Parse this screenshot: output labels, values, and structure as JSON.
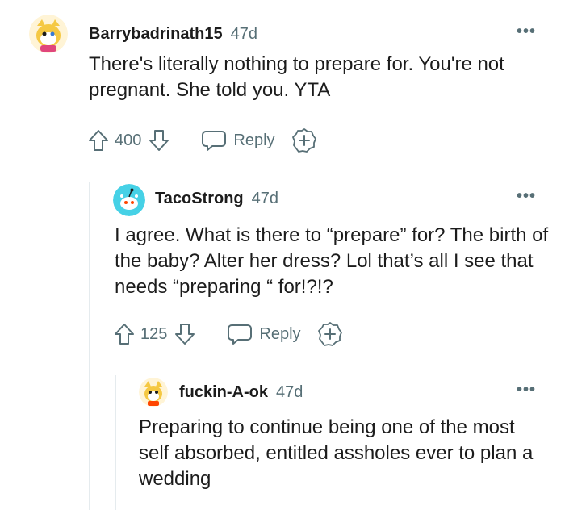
{
  "comments": [
    {
      "username": "Barrybadrinath15",
      "age": "47d",
      "text": "There's literally nothing to prepare for. You're not pregnant. She told you. YTA",
      "score": "400",
      "reply_label": "Reply",
      "more_label": "•••",
      "avatar_icon": "yellow-snoo-avatar-icon"
    },
    {
      "username": "TacoStrong",
      "age": "47d",
      "text": "I agree. What is there to “prepare” for? The birth of the baby? Alter her dress? Lol that’s all I see that needs “preparing “ for!?!?",
      "score": "125",
      "reply_label": "Reply",
      "more_label": "•••",
      "avatar_icon": "teal-snoo-avatar-icon"
    },
    {
      "username": "fuckin-A-ok",
      "age": "47d",
      "text": "Preparing to continue being one of the most self absorbed, entitled assholes ever to plan a wedding",
      "more_label": "•••",
      "avatar_icon": "yellow-snoo-avatar-icon"
    }
  ],
  "colors": {
    "text": "#1c1c1c",
    "meta": "#576f76",
    "thread_line": "#e5ebee",
    "avatar_teal": "#46d1e6",
    "avatar_yellow": "#f5c842"
  }
}
